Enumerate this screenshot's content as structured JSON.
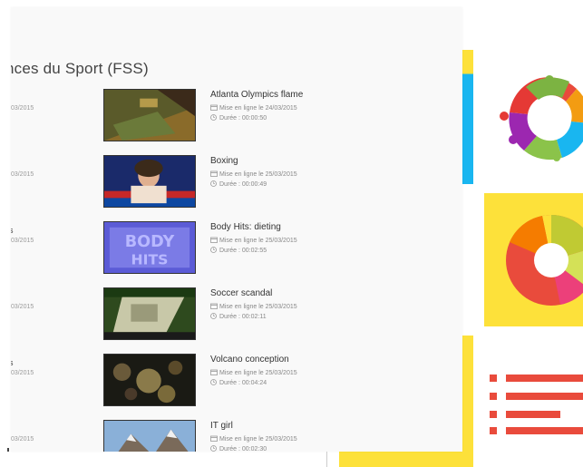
{
  "panel": {
    "title": "nces du Sport (FSS)"
  },
  "videos": [
    {
      "left_fragment": "",
      "left_date": "/03/2015",
      "title": "Atlanta Olympics flame",
      "date_text": "Mise en ligne le 24/03/2015",
      "duration_text": "Durée : 00:00:50",
      "thumb": "flame"
    },
    {
      "left_fragment": "",
      "left_date": "/03/2015",
      "title": "Boxing",
      "date_text": "Mise en ligne le 25/03/2015",
      "duration_text": "Durée : 00:00:49",
      "thumb": "news"
    },
    {
      "left_fragment": "s",
      "left_date": "/03/2015",
      "title": "Body Hits: dieting",
      "date_text": "Mise en ligne le 25/03/2015",
      "duration_text": "Durée : 00:02:55",
      "thumb": "bodyhits"
    },
    {
      "left_fragment": "",
      "left_date": "/03/2015",
      "title": "Soccer scandal",
      "date_text": "Mise en ligne le 25/03/2015",
      "duration_text": "Durée : 00:02:11",
      "thumb": "soccer"
    },
    {
      "left_fragment": "s",
      "left_date": "/03/2015",
      "title": "Volcano conception",
      "date_text": "Mise en ligne le 25/03/2015",
      "duration_text": "Durée : 00:04:24",
      "thumb": "volcano"
    },
    {
      "left_fragment": "",
      "left_date": "/03/2015",
      "title": "IT girl",
      "date_text": "Mise en ligne le 25/03/2015",
      "duration_text": "Durée : 00:02:30",
      "thumb": "mountain"
    }
  ],
  "icons": {
    "calendar": "calendar-icon",
    "clock": "clock-icon",
    "ring": "ring-chart-icon",
    "pie": "pie-chart-icon",
    "list": "list-icon"
  },
  "colors": {
    "yellow": "#fde13a",
    "cyan": "#19b6f0",
    "red": "#e94b3c",
    "panel_bg": "#f9f9f9"
  }
}
